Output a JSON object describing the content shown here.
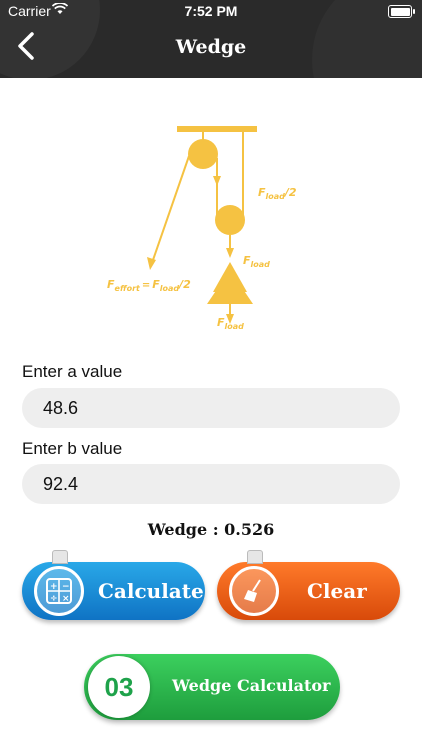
{
  "status": {
    "carrier": "Carrier",
    "time": "7:52 PM"
  },
  "nav": {
    "title": "Wedge"
  },
  "diagram": {
    "f_load_half": "F",
    "load_sub": "load",
    "half": "/2",
    "f_effort": "F",
    "effort_sub": "effort",
    "eq": "=",
    "f_load": "F"
  },
  "form": {
    "a_label": "Enter a value",
    "a_value": "48.6",
    "b_label": "Enter b value",
    "b_value": "92.4"
  },
  "result": {
    "text": "Wedge : 0.526"
  },
  "buttons": {
    "calculate": "Calculate",
    "clear": "Clear"
  },
  "footer": {
    "number": "03",
    "label": "Wedge Calculator"
  },
  "colors": {
    "accent_yellow": "#f5c242",
    "calc_blue": "#1a8fd8",
    "clear_orange": "#f06a1c",
    "green": "#27b24a"
  }
}
